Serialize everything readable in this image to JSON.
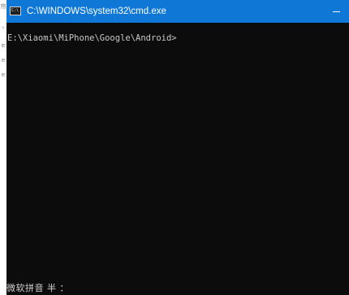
{
  "window": {
    "title": "C:\\WINDOWS\\system32\\cmd.exe",
    "icon_label": "C:\\"
  },
  "console": {
    "prompt": "E:\\Xiaomi\\MiPhone\\Google\\Android>",
    "ime_status": "微软拼音 半 ："
  },
  "colors": {
    "titlebar": "#0f78d7",
    "console_background": "#0c0c0c",
    "console_text": "#c8c8c8"
  }
}
